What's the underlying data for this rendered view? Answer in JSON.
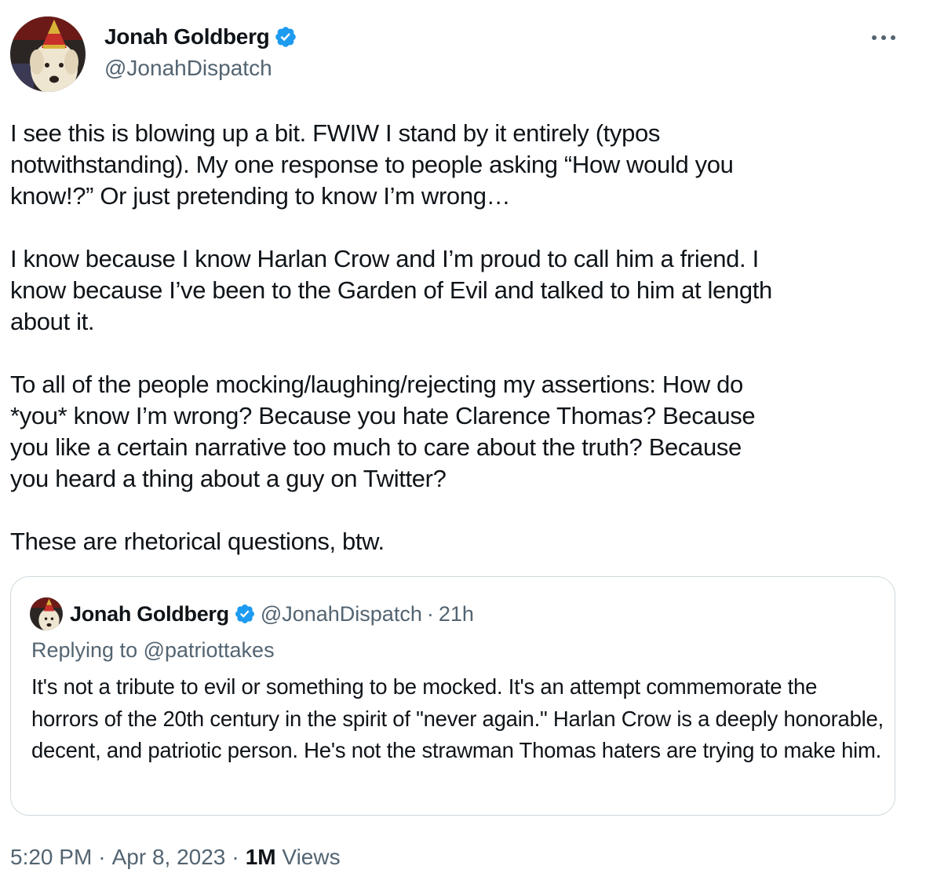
{
  "author": {
    "name": "Jonah Goldberg",
    "handle": "@JonahDispatch",
    "verified": true
  },
  "tweet": {
    "paragraphs": [
      "I see this is blowing up a bit. FWIW I stand by it entirely (typos\nnotwithstanding). My one response to people asking “How would you\nknow!?” Or just pretending to know I’m wrong…",
      "I know because I know Harlan Crow and I’m proud to call him a friend. I\nknow because I’ve been to the Garden of Evil and talked to him at length\nabout it.",
      "To all of the people mocking/laughing/rejecting my assertions: How do\n*you* know I’m wrong? Because you hate Clarence Thomas? Because\nyou like a certain narrative too much to care about the truth? Because\nyou heard a thing about a guy on Twitter?",
      "These are rhetorical questions, btw."
    ]
  },
  "quote": {
    "name": "Jonah Goldberg",
    "handle": "@JonahDispatch",
    "separator": "·",
    "time": "21h",
    "replying_to": "Replying to @patriottakes",
    "text": "It's not a tribute to evil or something to be mocked. It's an attempt commemorate the horrors of the 20th century in the spirit of \"never again.\" Harlan Crow is a deeply honorable, decent, and patriotic person.  He's not the strawman Thomas haters are trying to make him."
  },
  "footer": {
    "time": "5:20 PM",
    "separator": "·",
    "date": "Apr 8, 2023",
    "views_count": "1M",
    "views_label": "Views"
  },
  "icons": {
    "verified": "verified-badge-icon",
    "more": "more-options-icon"
  },
  "colors": {
    "text": "#0f1419",
    "secondary": "#536471",
    "verified_blue": "#1d9bf0",
    "border": "#cfd9de"
  }
}
